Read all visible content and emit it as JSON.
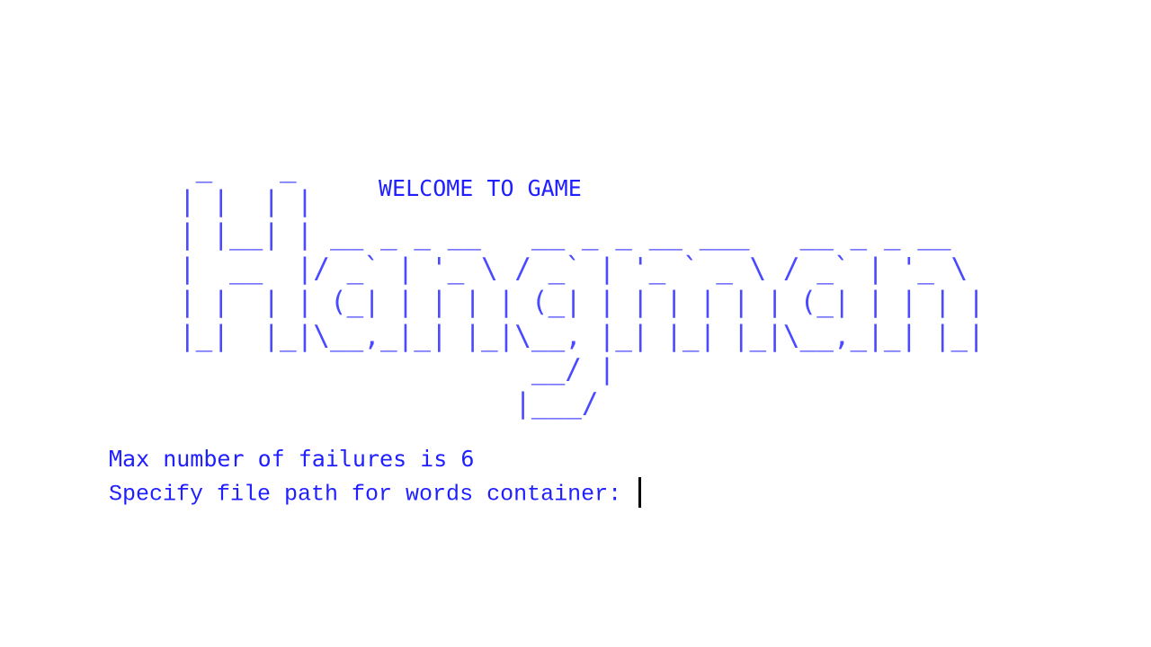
{
  "console": {
    "banner_lines": [
      " _    _",
      "| |  | |",
      "| |__| | __ _ _ __   __ _ _ __ ___   __ _ _ __",
      "|  __  |/ _` | '_ \\ / _` | '_ ` _ \\ / _` | '_ \\",
      "| |  | | (_| | | | | (_| | | | | | | (_| | | | |",
      "|_|  |_|\\__,_|_| |_|\\__, |_| |_| |_|\\__,_|_| |_|",
      "                     __/ |",
      "                    |___/"
    ],
    "welcome_text": "WELCOME TO GAME",
    "max_failures_text": "Max number of failures is 6",
    "prompt_text": "Specify file path for words container: ",
    "colors": {
      "text": "#1f1fff",
      "banner": "#4a4aff",
      "background": "#ffffff",
      "cursor": "#000000"
    }
  }
}
